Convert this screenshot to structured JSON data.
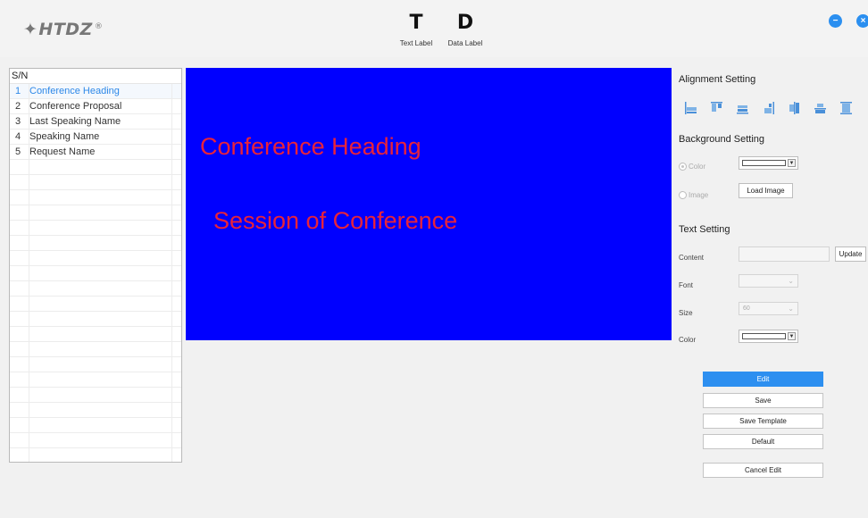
{
  "app": {
    "logo_text": "HTDZ",
    "logo_mark": "✦",
    "logo_reg": "®"
  },
  "toolbar": {
    "text_label": {
      "glyph": "T",
      "caption": "Text Label"
    },
    "data_label": {
      "glyph": "D",
      "caption": "Data Label"
    }
  },
  "window": {
    "minimize_glyph": "−",
    "close_glyph": "×"
  },
  "sn_list": {
    "header": "S/N",
    "items": [
      {
        "num": "1",
        "label": "Conference Heading"
      },
      {
        "num": "2",
        "label": "Conference Proposal"
      },
      {
        "num": "3",
        "label": "Last Speaking Name"
      },
      {
        "num": "4",
        "label": "Speaking Name"
      },
      {
        "num": "5",
        "label": "Request Name"
      }
    ],
    "selected_index": 0
  },
  "canvas": {
    "background_color": "#0000ff",
    "text_color": "#e8233a",
    "line1": "Conference Heading",
    "line2": "Session of Conference"
  },
  "alignment": {
    "title": "Alignment Setting",
    "icons": [
      "align-left-icon",
      "align-top-icon",
      "align-bottom-icon",
      "align-right-icon",
      "align-middle-icon",
      "align-center-icon",
      "align-stretch-icon"
    ]
  },
  "background": {
    "title": "Background Setting",
    "color_label": "Color",
    "image_label": "Image",
    "load_image_label": "Load Image",
    "selected": "Color"
  },
  "text_setting": {
    "title": "Text Setting",
    "content_label": "Content",
    "content_value": "",
    "update_label": "Update",
    "font_label": "Font",
    "font_value": "",
    "size_label": "Size",
    "size_value": "60",
    "color_label": "Color"
  },
  "actions": {
    "edit": "Edit",
    "save": "Save",
    "save_template": "Save Template",
    "default": "Default",
    "cancel_edit": "Cancel Edit"
  },
  "colors": {
    "accent": "#2d8ff0",
    "selected_text": "#2d88e8"
  }
}
